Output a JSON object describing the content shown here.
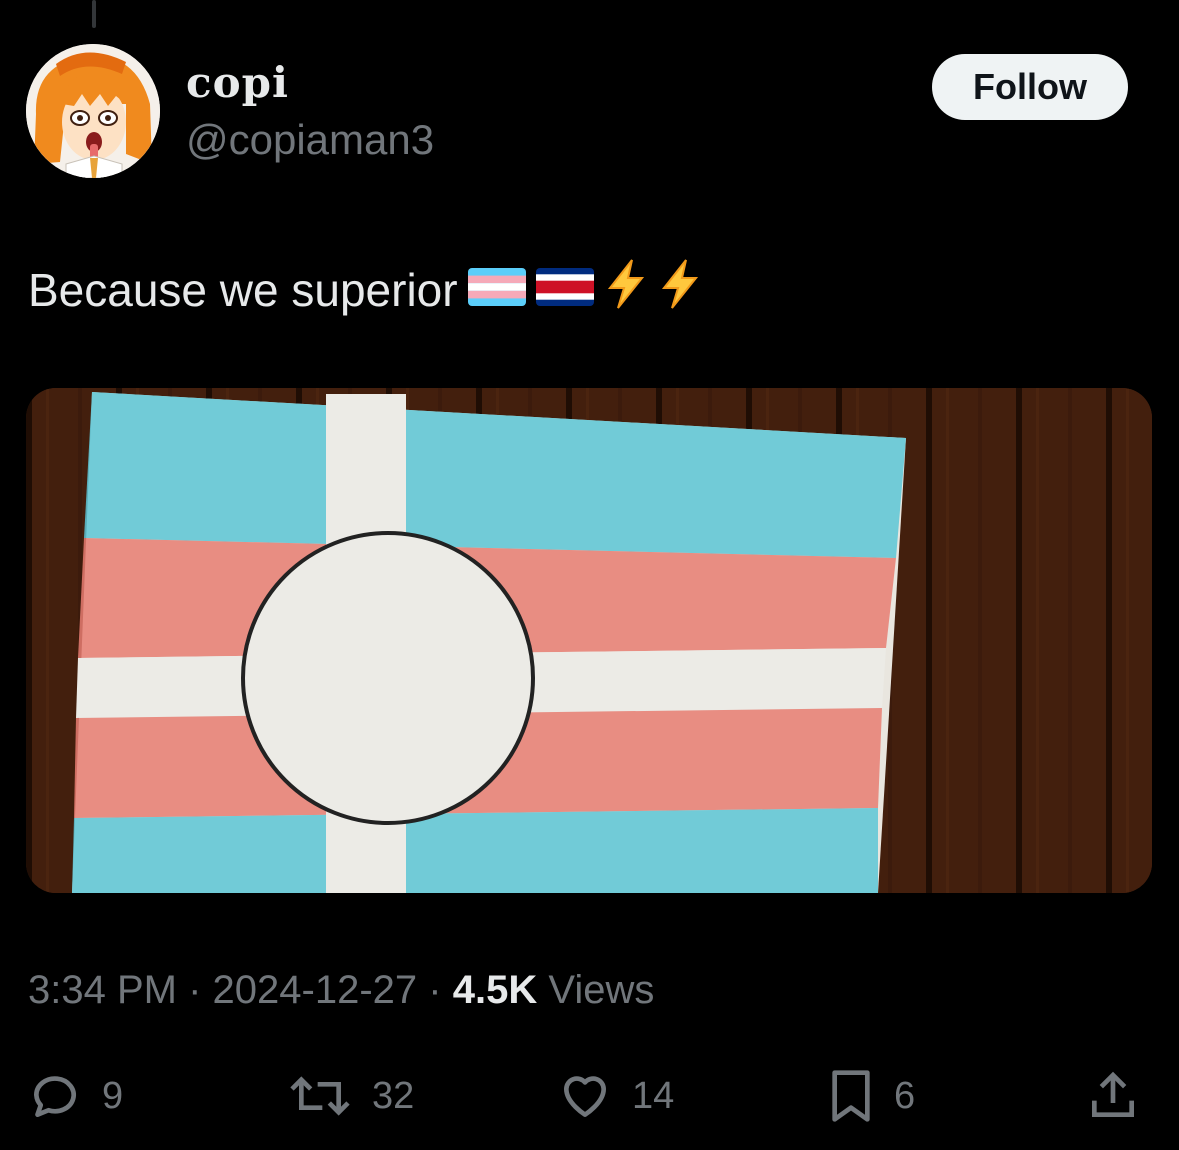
{
  "author": {
    "display_name": "copi",
    "handle": "@copiaman3"
  },
  "follow_label": "Follow",
  "tweet": {
    "text": "Because we superior",
    "emojis": [
      "transgender-flag",
      "costa-rica-flag",
      "high-voltage",
      "high-voltage"
    ]
  },
  "media": {
    "description_icon": "photo-of-hand-drawn-flag"
  },
  "meta": {
    "time": "3:34 PM",
    "separator": "·",
    "date": "2024-12-27",
    "views_count": "4.5K",
    "views_label": "Views"
  },
  "actions": {
    "replies": "9",
    "reposts": "32",
    "likes": "14",
    "bookmarks": "6"
  },
  "colors": {
    "background": "#000000",
    "primary_text": "#e7e9ea",
    "secondary_text": "#71767b",
    "follow_bg": "#eff3f4"
  }
}
